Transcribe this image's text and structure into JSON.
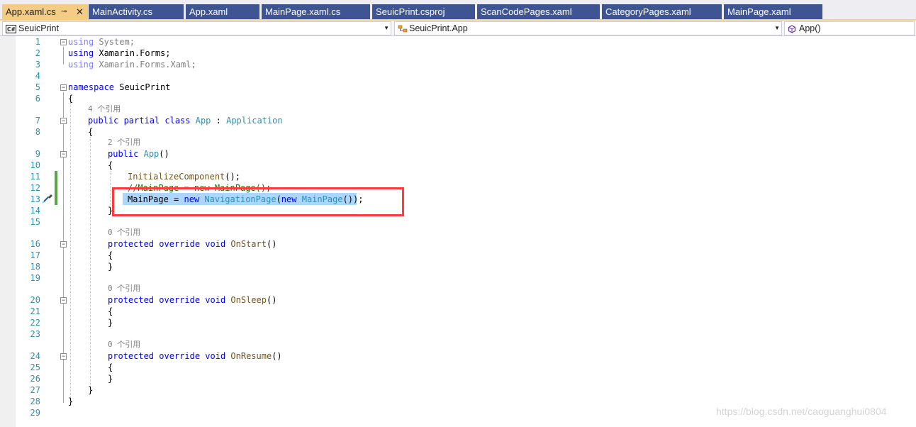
{
  "tabs": [
    {
      "label": "App.xaml.cs",
      "active": true
    },
    {
      "label": "MainActivity.cs"
    },
    {
      "label": "App.xaml"
    },
    {
      "label": "MainPage.xaml.cs"
    },
    {
      "label": "SeuicPrint.csproj"
    },
    {
      "label": "ScanCodePages.xaml"
    },
    {
      "label": "CategoryPages.xaml"
    },
    {
      "label": "MainPage.xaml"
    }
  ],
  "tab_pin_glyph": "⊸",
  "tab_close_glyph": "✕",
  "navbar": {
    "project": "SeuicPrint",
    "project_icon": "C#",
    "type": "SeuicPrint.App",
    "member": "App()",
    "dropdown_glyph": "▼"
  },
  "line_numbers": [
    "1",
    "2",
    "3",
    "4",
    "5",
    "6",
    "7",
    "8",
    "9",
    "10",
    "11",
    "12",
    "13",
    "14",
    "15",
    "16",
    "17",
    "18",
    "19",
    "20",
    "21",
    "22",
    "23",
    "24",
    "25",
    "26",
    "27",
    "28",
    "29"
  ],
  "code": {
    "l1": {
      "kw": "using",
      "rest": " System;"
    },
    "l2": {
      "kw": "using",
      "rest": " Xamarin.Forms;"
    },
    "l3": {
      "kw": "using",
      "rest": " Xamarin.Forms.Xaml;"
    },
    "l5": {
      "kw": "namespace",
      "rest": " SeuicPrint"
    },
    "l6": "{",
    "l7": {
      "kw": "public partial class",
      "type": "App",
      "sep": " : ",
      "base": "Application"
    },
    "l8": "{",
    "l9": {
      "kw": "public",
      "type": "App",
      "rest": "()"
    },
    "l10": "{",
    "l11": {
      "method": "InitializeComponent",
      "rest": "();"
    },
    "l12": "//MainPage = new MainPage();",
    "l13": {
      "lhs": "MainPage = ",
      "kw1": "new",
      "type1": "NavigationPage",
      "open": "(",
      "kw2": "new",
      "type2": "MainPage",
      "close": "());"
    },
    "l14": "}",
    "l16": {
      "kw": "protected override void",
      "method": "OnStart",
      "rest": "()"
    },
    "l17": "{",
    "l18": "}",
    "l20": {
      "kw": "protected override void",
      "method": "OnSleep",
      "rest": "()"
    },
    "l21": "{",
    "l22": "}",
    "l24": {
      "kw": "protected override void",
      "method": "OnResume",
      "rest": "()"
    },
    "l25": "{",
    "l26": "}",
    "l27": "}",
    "l28": "}"
  },
  "codelens": {
    "class_refs": "4 个引用",
    "ctor_refs": "2 个引用",
    "onstart_refs": "0 个引用",
    "onsleep_refs": "0 个引用",
    "onresume_refs": "0 个引用"
  },
  "fold_glyph": "−",
  "watermark": "https://blog.csdn.net/caoguanghui0804",
  "colors": {
    "keyword": "#0000ff",
    "type": "#2b91af",
    "method": "#74531f",
    "selection": "#add6ff",
    "highlight_box": "#ff3b3b",
    "active_tab": "#f5cc84",
    "inactive_tab": "#3f5493",
    "change_bar": "#57a64a"
  }
}
